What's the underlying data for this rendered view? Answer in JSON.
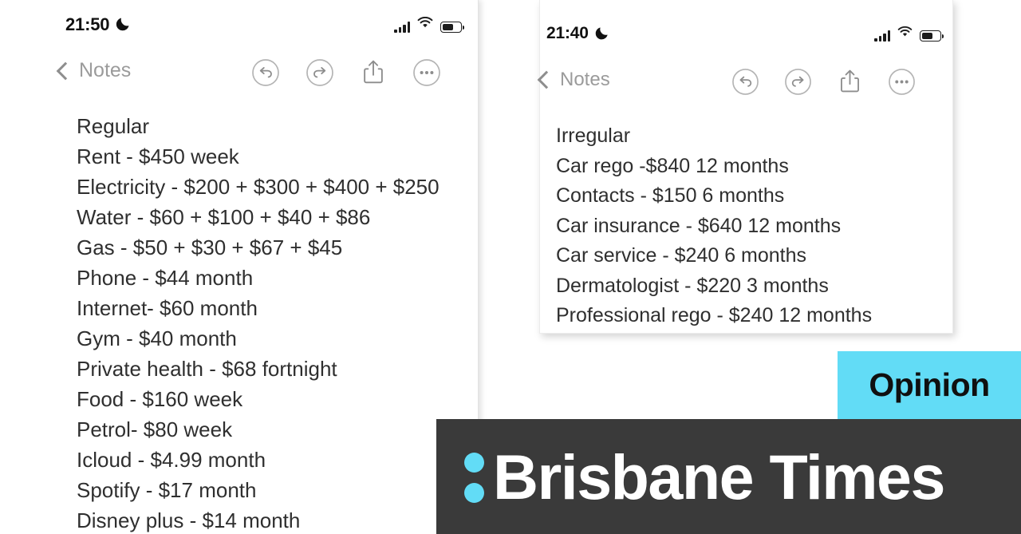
{
  "left_screenshot": {
    "status": {
      "time": "21:50",
      "moon_icon": "crescent-moon-icon",
      "signal_icon": "cellular-signal-icon",
      "wifi_icon": "wifi-icon",
      "battery_icon": "battery-icon"
    },
    "navbar": {
      "back_label": "Notes",
      "back_icon": "chevron-left-icon",
      "tools": [
        {
          "name": "undo-icon",
          "label": "Undo"
        },
        {
          "name": "redo-icon",
          "label": "Redo"
        },
        {
          "name": "share-icon",
          "label": "Share"
        },
        {
          "name": "more-icon",
          "label": "More"
        }
      ]
    },
    "note": {
      "title": "Regular",
      "lines": [
        "Rent - $450 week",
        "Electricity - $200 + $300 + $400 + $250",
        "Water - $60 + $100 + $40 + $86",
        "Gas - $50 + $30 + $67 + $45",
        "Phone - $44 month",
        "Internet- $60 month",
        "Gym - $40 month",
        "Private health - $68 fortnight",
        "Food - $160 week",
        "Petrol- $80 week",
        "Icloud - $4.99 month",
        "Spotify - $17 month",
        "Disney plus - $14 month"
      ]
    }
  },
  "right_screenshot": {
    "status": {
      "time": "21:40",
      "moon_icon": "crescent-moon-icon",
      "signal_icon": "cellular-signal-icon",
      "wifi_icon": "wifi-icon",
      "battery_icon": "battery-icon"
    },
    "navbar": {
      "back_label": "Notes",
      "back_icon": "chevron-left-icon",
      "tools": [
        {
          "name": "undo-icon",
          "label": "Undo"
        },
        {
          "name": "redo-icon",
          "label": "Redo"
        },
        {
          "name": "share-icon",
          "label": "Share"
        },
        {
          "name": "more-icon",
          "label": "More"
        }
      ]
    },
    "note": {
      "title": "Irregular",
      "lines": [
        "Car rego -$840 12 months",
        "Contacts - $150 6 months",
        "Car insurance - $640 12 months",
        "Car service - $240 6 months",
        "Dermatologist - $220 3 months",
        "Professional rego - $240 12 months"
      ]
    }
  },
  "overlay": {
    "opinion_badge": "Opinion",
    "masthead_title": "Brisbane Times",
    "colon_icon": "colon-dots-icon"
  },
  "colors": {
    "accent_cyan": "#62dcf6",
    "masthead_dark": "#3a3a3a",
    "note_text": "#2f2f2f",
    "nav_gray": "#9b9b9b",
    "page_background": "#ffffff"
  }
}
